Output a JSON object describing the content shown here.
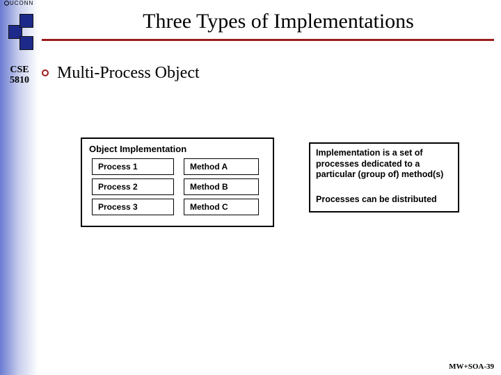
{
  "branding": {
    "uconn": "UCONN"
  },
  "title": "Three Types of Implementations",
  "course": {
    "dept": "CSE",
    "num": "5810"
  },
  "bullet": {
    "label": "Multi-Process Object"
  },
  "impl": {
    "heading": "Object Implementation",
    "rows": [
      {
        "proc": "Process 1",
        "meth": "Method A"
      },
      {
        "proc": "Process 2",
        "meth": "Method B"
      },
      {
        "proc": "Process 3",
        "meth": "Method C"
      }
    ]
  },
  "desc": {
    "p1": "Implementation is a set of processes dedicated to a particular (group of) method(s)",
    "p2": "Processes can be distributed"
  },
  "footer": "MW+SOA-39"
}
